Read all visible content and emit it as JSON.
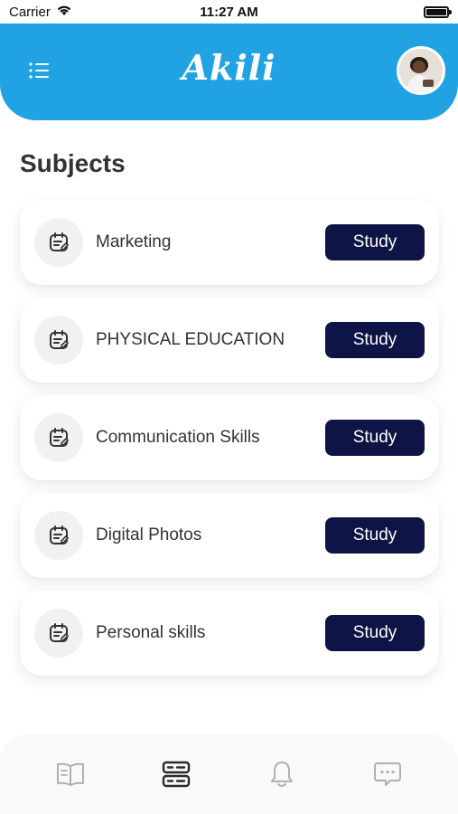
{
  "status_bar": {
    "carrier": "Carrier",
    "time": "11:27 AM"
  },
  "header": {
    "logo_text": "Akili",
    "accent_color": "#21a3e3"
  },
  "page": {
    "title": "Subjects"
  },
  "subjects": [
    {
      "name": "Marketing",
      "button_label": "Study"
    },
    {
      "name": "PHYSICAL EDUCATION",
      "button_label": "Study"
    },
    {
      "name": "Communication Skills",
      "button_label": "Study"
    },
    {
      "name": "Digital Photos",
      "button_label": "Study"
    },
    {
      "name": "Personal skills",
      "button_label": "Study"
    }
  ],
  "bottom_nav": {
    "items": [
      "book-icon",
      "subjects-list-icon",
      "bell-icon",
      "chat-icon"
    ],
    "active": "subjects-list-icon"
  },
  "colors": {
    "button_bg": "#0e1445",
    "icon_gray": "#b0b0b0",
    "active_icon": "#2a2a2a"
  }
}
